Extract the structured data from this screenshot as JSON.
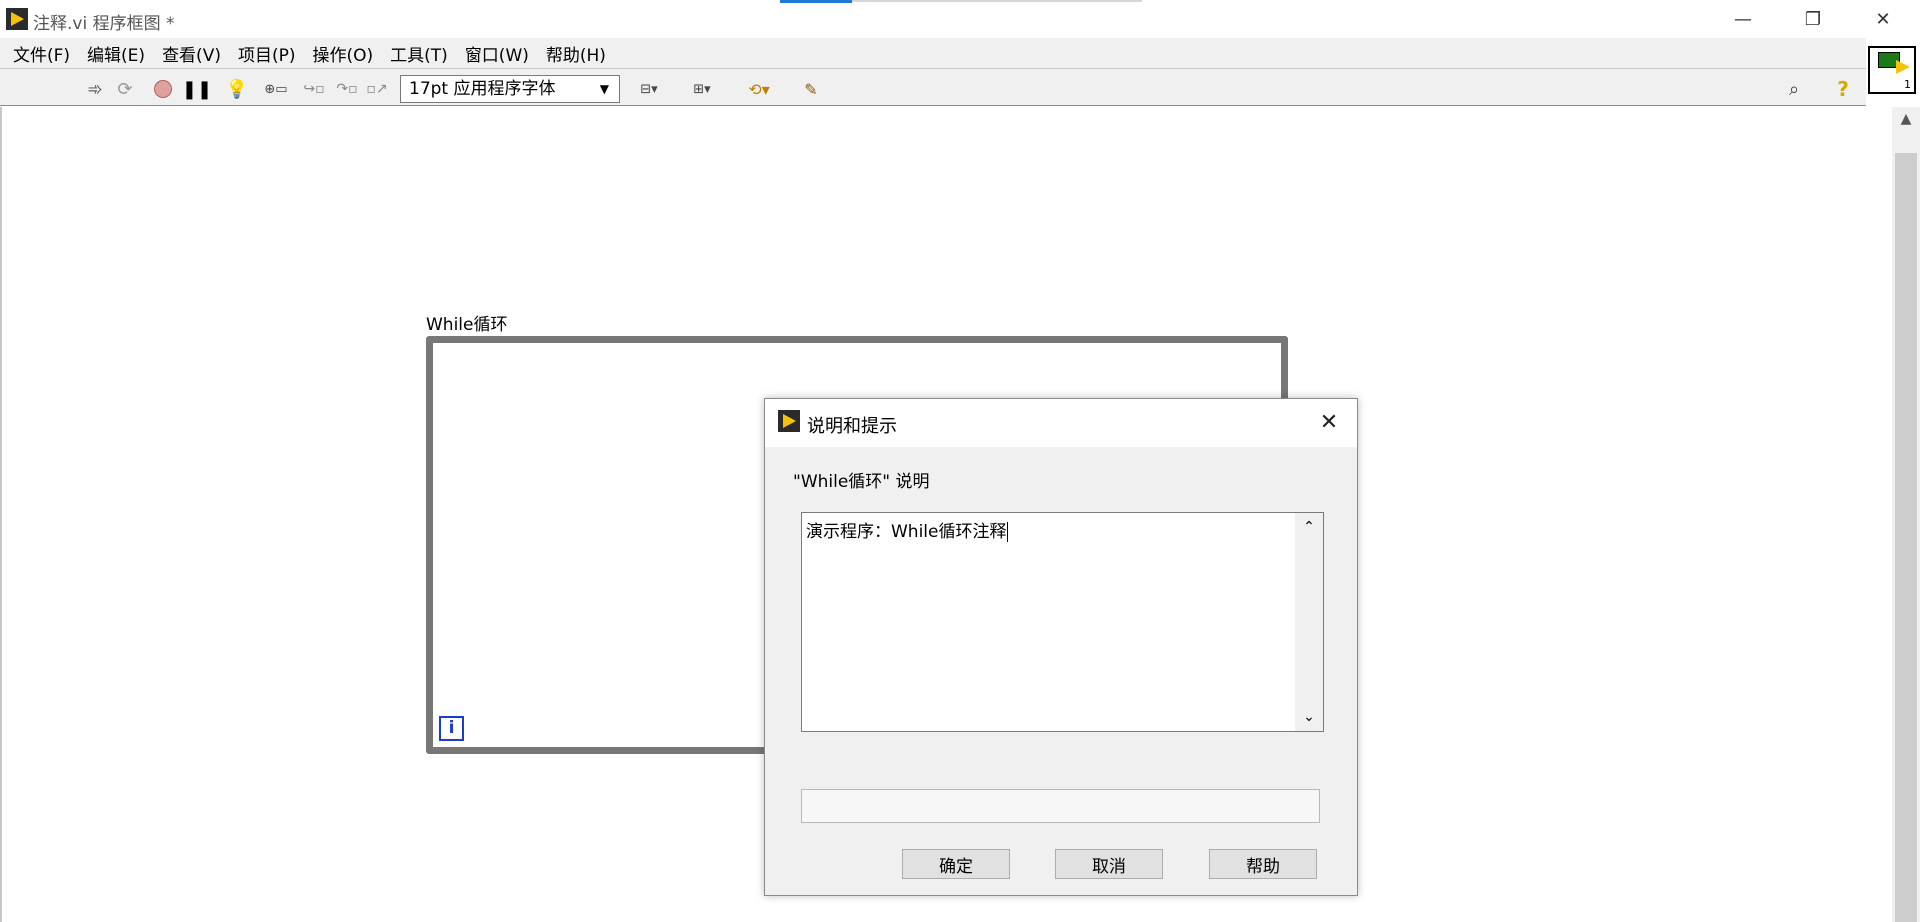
{
  "window": {
    "title": "注释.vi 程序框图 *"
  },
  "menu": [
    "文件(F)",
    "编辑(E)",
    "查看(V)",
    "项目(P)",
    "操作(O)",
    "工具(T)",
    "窗口(W)",
    "帮助(H)"
  ],
  "toolbar": {
    "font": "17pt 应用程序字体"
  },
  "vi_icon": {
    "number": "1"
  },
  "diagram": {
    "loop_label": "While循环",
    "iteration_terminal": "i"
  },
  "dialog": {
    "title": "说明和提示",
    "description_label": "\"While循环\" 说明",
    "description_text": "演示程序：While循环注释",
    "tip_text": "",
    "ok": "确定",
    "cancel": "取消",
    "help": "帮助"
  }
}
